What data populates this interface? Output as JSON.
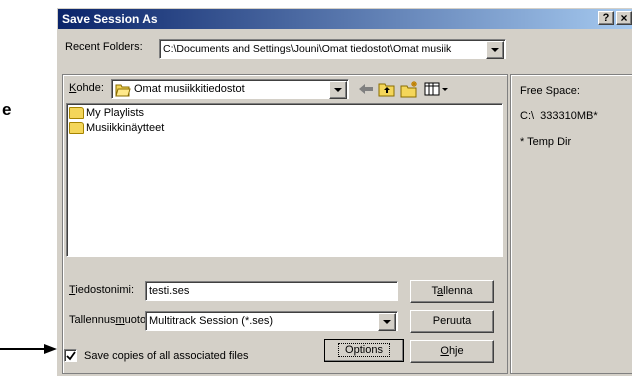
{
  "annotation": {
    "side_label": "e"
  },
  "dialog": {
    "title": "Save Session As",
    "help_btn": "?",
    "close_btn": "×",
    "recent_label": "Recent Folders:",
    "recent_value": "C:\\Documents and Settings\\Jouni\\Omat tiedostot\\Omat musiik",
    "lookin_label_u": "K",
    "lookin_label_rest": "ohde:",
    "lookin_value": "Omat musiikkitiedostot",
    "files": [
      {
        "name": "My Playlists"
      },
      {
        "name": "Musiikkinäytteet"
      }
    ],
    "filename_label_u": "T",
    "filename_label_rest": "iedostonimi:",
    "filename_value": "testi.ses",
    "filetype_label_a": "Tallennus",
    "filetype_label_u": "m",
    "filetype_label_b": "uoto",
    "filetype_value": "Multitrack Session (*.ses)",
    "save_btn_a": "T",
    "save_btn_u": "a",
    "save_btn_b": "llenna",
    "cancel_btn": "Peruuta",
    "options_btn": "Options",
    "help2_btn_u": "O",
    "help2_btn_rest": "hje",
    "checkbox_checked": true,
    "checkbox_label": "Save copies of all associated files",
    "info": {
      "free_space_label": "Free Space:",
      "drive_line": "C:\\  333310MB*",
      "temp_note": "* Temp Dir"
    }
  }
}
